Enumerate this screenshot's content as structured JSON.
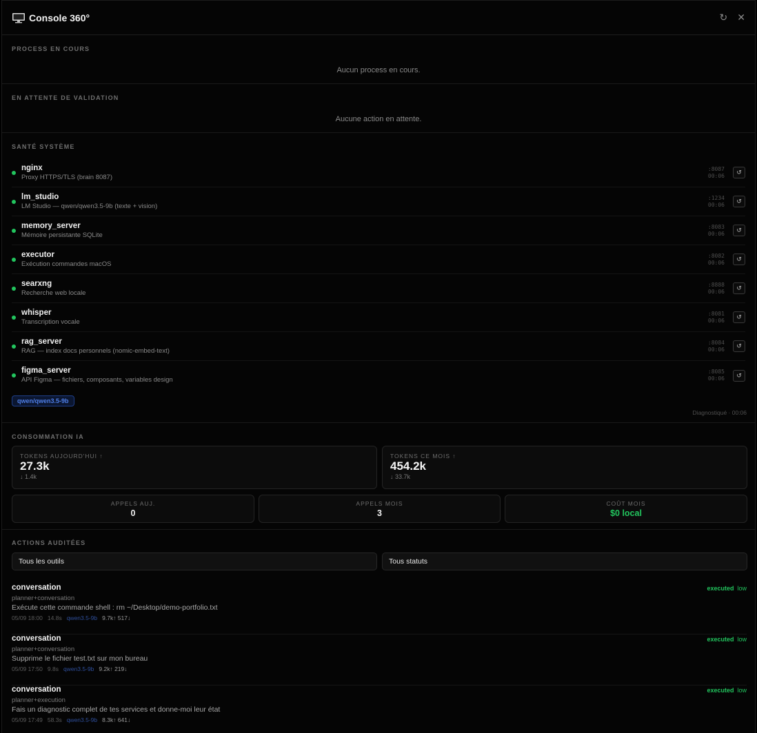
{
  "header": {
    "title": "Console 360°",
    "refresh_icon": "↻",
    "close_icon": "✕"
  },
  "processes": {
    "title": "PROCESS EN COURS",
    "empty": "Aucun process en cours."
  },
  "pending": {
    "title": "EN ATTENTE DE VALIDATION",
    "empty": "Aucune action en attente."
  },
  "health": {
    "title": "SANTÉ SYSTÈME",
    "status_color": "#22c55e",
    "services": [
      {
        "name": "nginx",
        "desc": "Proxy HTTPS/TLS (brain 8087)",
        "port": ":8087",
        "time": "00:06"
      },
      {
        "name": "lm_studio",
        "desc": "LM Studio — qwen/qwen3.5-9b (texte + vision)",
        "port": ":1234",
        "time": "00:06"
      },
      {
        "name": "memory_server",
        "desc": "Mémoire persistante SQLite",
        "port": ":8083",
        "time": "00:06"
      },
      {
        "name": "executor",
        "desc": "Exécution commandes macOS",
        "port": ":8082",
        "time": "00:06"
      },
      {
        "name": "searxng",
        "desc": "Recherche web locale",
        "port": ":8888",
        "time": "00:06"
      },
      {
        "name": "whisper",
        "desc": "Transcription vocale",
        "port": ":8081",
        "time": "00:06"
      },
      {
        "name": "rag_server",
        "desc": "RAG — index docs personnels (nomic-embed-text)",
        "port": ":8084",
        "time": "00:06"
      },
      {
        "name": "figma_server",
        "desc": "API Figma — fichiers, composants, variables design",
        "port": ":8085",
        "time": "00:06"
      }
    ],
    "restart_icon": "↺",
    "model_badge": "qwen/qwen3.5-9b",
    "diagnostic": "Diagnostiqué · 00:06"
  },
  "usage": {
    "title": "CONSOMMATION IA",
    "tokens_today": {
      "label": "TOKENS AUJOURD'HUI ↑",
      "value": "27.3k",
      "sub": "↓ 1.4k"
    },
    "tokens_month": {
      "label": "TOKENS CE MOIS ↑",
      "value": "454.2k",
      "sub": "↓ 33.7k"
    },
    "calls_today": {
      "label": "APPELS AUJ.",
      "value": "0"
    },
    "calls_month": {
      "label": "APPELS MOIS",
      "value": "3"
    },
    "cost_month": {
      "label": "COÛT MOIS",
      "value": "$0 local"
    }
  },
  "audit": {
    "title": "ACTIONS AUDITÉES",
    "filter_tools": "Tous les outils",
    "filter_status": "Tous statuts",
    "entries": [
      {
        "title": "conversation",
        "tags": "planner+conversation",
        "message": "Exécute cette commande shell : rm ~/Desktop/demo-portfolio.txt",
        "date": "05/09 18:00",
        "duration": "14.8s",
        "model": "qwen3.5-9b",
        "tokens": "9.7k↑ 517↓",
        "status": "executed",
        "risk": "low"
      },
      {
        "title": "conversation",
        "tags": "planner+conversation",
        "message": "Supprime le fichier test.txt sur mon bureau",
        "date": "05/09 17:50",
        "duration": "9.8s",
        "model": "qwen3.5-9b",
        "tokens": "9.2k↑ 219↓",
        "status": "executed",
        "risk": "low"
      },
      {
        "title": "conversation",
        "tags": "planner+execution",
        "message": "Fais un diagnostic complet de tes services et donne-moi leur état",
        "date": "05/09 17:49",
        "duration": "58.3s",
        "model": "qwen3.5-9b",
        "tokens": "8.3k↑ 641↓",
        "status": "executed",
        "risk": "low"
      }
    ]
  }
}
